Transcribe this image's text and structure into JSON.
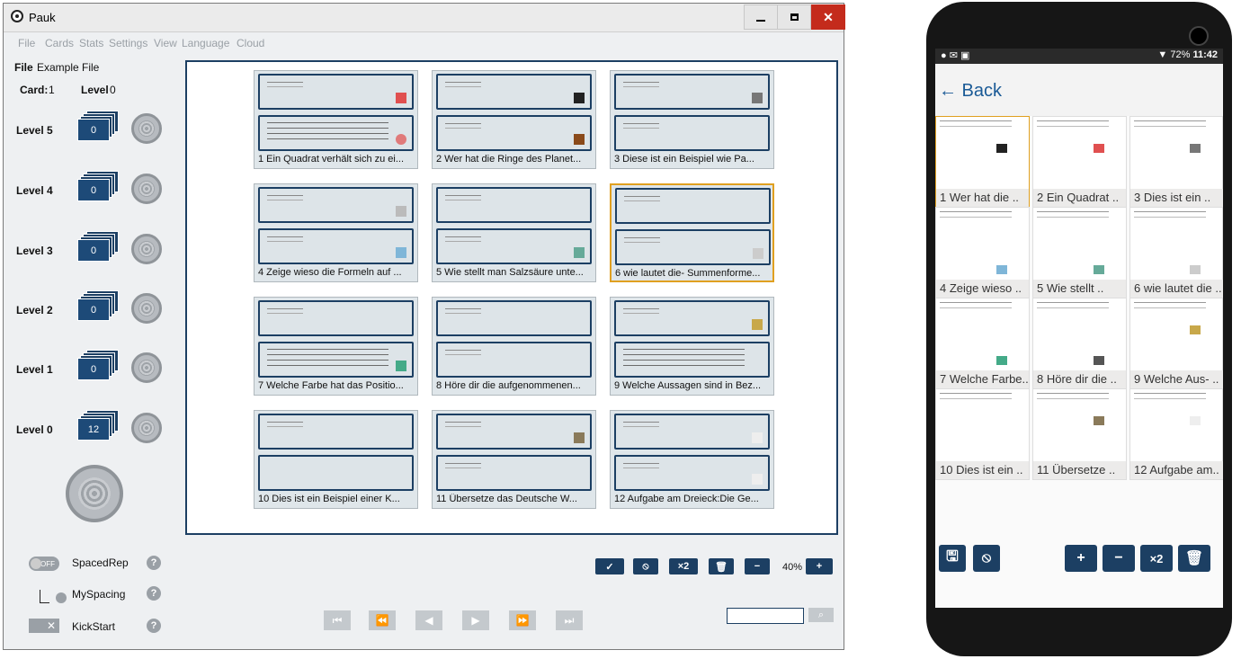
{
  "window": {
    "title": "Pauk",
    "min_icon": "minimize-icon",
    "max_icon": "maximize-icon",
    "close_icon": "close-icon"
  },
  "menu": [
    "File",
    "Cards",
    "Stats",
    "Settings",
    "View",
    "Language",
    "Cloud"
  ],
  "left_panel": {
    "file_label": "File",
    "file_name": "Example File",
    "card_label": "Card:",
    "card_value": "1",
    "level_label": "Level",
    "level_value": "0",
    "levels": [
      {
        "label": "Level 5",
        "count": "0"
      },
      {
        "label": "Level 4",
        "count": "0"
      },
      {
        "label": "Level 3",
        "count": "0"
      },
      {
        "label": "Level 2",
        "count": "0"
      },
      {
        "label": "Level 1",
        "count": "0"
      },
      {
        "label": "Level 0",
        "count": "12"
      }
    ],
    "spacedrep_label": "SpacedRep",
    "spacedrep_toggle": "OFF",
    "myspacing_label": "MySpacing",
    "kickstart_label": "KickStart",
    "help": "?"
  },
  "cards": [
    {
      "caption": "1   Ein Quadrat verhält sich zu ei..."
    },
    {
      "caption": "2   Wer hat die Ringe des Planet..."
    },
    {
      "caption": "3   Diese ist ein Beispiel wie Pa..."
    },
    {
      "caption": "4   Zeige wieso die Formeln auf ..."
    },
    {
      "caption": "5   Wie stellt man Salzsäure unte..."
    },
    {
      "caption": "6   wie lautet die- Summenforme..."
    },
    {
      "caption": "7   Welche Farbe hat das Positio..."
    },
    {
      "caption": "8   Höre dir die aufgenommenen..."
    },
    {
      "caption": "9   Welche Aussagen sind in Bez..."
    },
    {
      "caption": "10   Dies ist ein Beispiel einer K..."
    },
    {
      "caption": "11   Übersetze das Deutsche W..."
    },
    {
      "caption": "12   Aufgabe am Dreieck:Die Ge..."
    }
  ],
  "toolbar": {
    "check": "✓",
    "block": "⦸",
    "x2": "×2",
    "trash": "🗑",
    "minus": "−",
    "zoom": "40%",
    "plus": "+"
  },
  "nav": {
    "first": "⏮",
    "prev_fast": "⏪",
    "prev": "◀",
    "next": "▶",
    "next_fast": "⏩",
    "last": "⏭",
    "search_icon": "search-icon",
    "search_glyph": "⌕"
  },
  "phone": {
    "status_battery": "72%",
    "status_time": "11:42",
    "back_label": "← Back",
    "cards": [
      {
        "caption": "1 Wer hat die   .."
      },
      {
        "caption": "2 Ein Quadrat   .."
      },
      {
        "caption": "3 Dies ist ein   .."
      },
      {
        "caption": "4 Zeige wieso   .."
      },
      {
        "caption": "5 Wie stellt   .."
      },
      {
        "caption": "6 wie lautet die .."
      },
      {
        "caption": "7 Welche Farbe.."
      },
      {
        "caption": "8 Höre dir die   .."
      },
      {
        "caption": "9 Welche Aus-   .."
      },
      {
        "caption": "10 Dies ist ein   .."
      },
      {
        "caption": "11 Übersetze   .."
      },
      {
        "caption": "12 Aufgabe am.."
      }
    ],
    "buttons": {
      "save": "🖫",
      "block": "⦸",
      "plus": "+",
      "minus": "−",
      "x2": "×2",
      "trash": "🗑"
    }
  },
  "colors": {
    "accent": "#1c3f63",
    "selected": "#e0a020",
    "close": "#c42b1c"
  }
}
